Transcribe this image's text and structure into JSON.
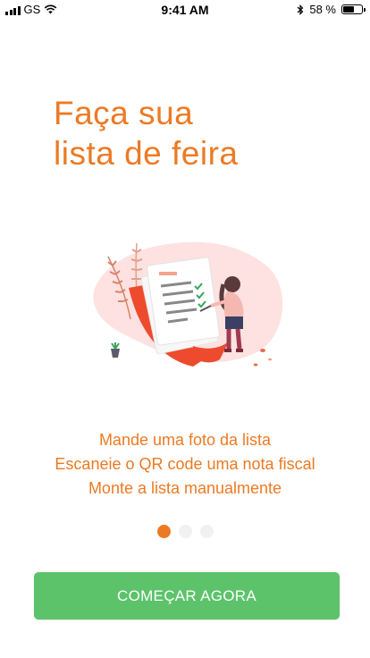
{
  "status_bar": {
    "carrier": "GS",
    "time": "9:41 AM",
    "battery": "58 %",
    "battery_level": 0.58,
    "icons": [
      "signal-icon",
      "wifi-icon",
      "bluetooth-icon",
      "battery-icon"
    ]
  },
  "onboarding": {
    "title_line1": "Faça sua",
    "title_line2": "lista de feira",
    "features": [
      "Mande uma foto da lista",
      "Escaneie o QR code uma nota fiscal",
      "Monte a lista manualmente"
    ],
    "pager": {
      "total": 3,
      "active": 1
    },
    "cta_label": "COMEÇAR AGORA"
  },
  "colors": {
    "accent": "#ec7a24",
    "button": "#5cc36a",
    "dot_inactive": "#f1f1f1"
  }
}
